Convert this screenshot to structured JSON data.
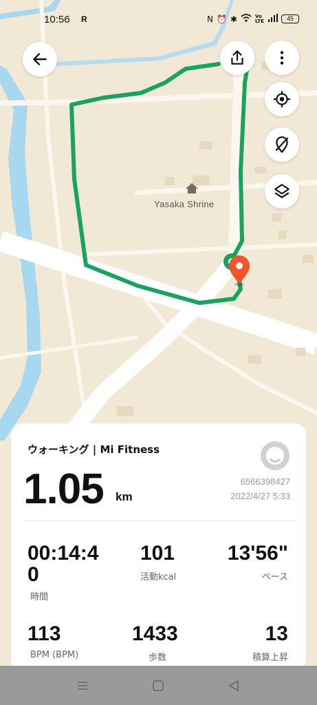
{
  "status_bar": {
    "time": "10:56",
    "carrier_badge": "R",
    "signal_text": "Vo LTE",
    "battery": "45",
    "icons": [
      "nfc-icon",
      "alarm-icon",
      "bluetooth-icon",
      "wifi-icon",
      "cell-signal-icon"
    ]
  },
  "map": {
    "place_label": "Yasaka Shrine",
    "route_color": "#1aa260",
    "end_marker_color": "#f0552a",
    "start_marker_color": "#1aa260",
    "water_color": "#a8d8ef",
    "land_color": "#f2e8d6"
  },
  "toolbar": {
    "back_icon": "arrow-left-icon",
    "share_icon": "share-icon",
    "more_icon": "more-vertical-icon",
    "locate_icon": "locate-icon",
    "hide_route_icon": "location-off-icon",
    "layers_icon": "layers-icon"
  },
  "workout": {
    "title": "ウォーキング | Mi Fitness",
    "distance": "1.05",
    "distance_unit": "km",
    "user_id": "6566398427",
    "datetime": "2022/4/27 5:33",
    "stats": [
      {
        "value": "00:14:4\n0",
        "label": "時間"
      },
      {
        "value": "101",
        "label": "活動kcal"
      },
      {
        "value": "13'56\"",
        "label": "ペース"
      },
      {
        "value": "113",
        "label": "BPM (BPM)"
      },
      {
        "value": "1433",
        "label": "歩数"
      },
      {
        "value": "13",
        "label": "積算上昇"
      }
    ]
  },
  "nav_bar": {
    "buttons": [
      "menu-icon",
      "home-icon",
      "back-triangle-icon"
    ]
  }
}
